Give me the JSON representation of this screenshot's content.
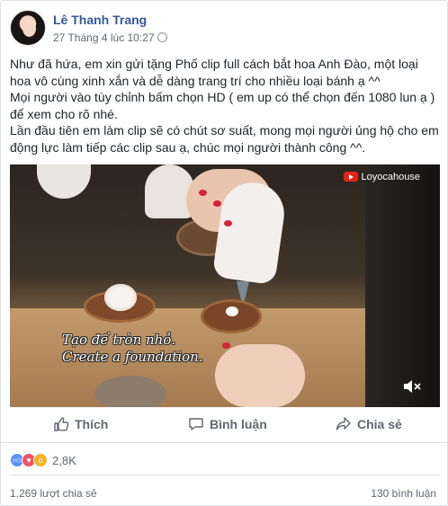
{
  "post": {
    "author": "Lê Thanh Trang",
    "timestamp": "27 Tháng 4 lúc 10:27",
    "privacy_icon": "globe-icon",
    "text_paragraphs": [
      "Như đã hứa, em xin gửi tặng Phố clip full cách bắt hoa Anh Đào, một loại hoa vô cùng xinh xắn và dễ dàng trang trí cho nhiều loại bánh ạ ^^",
      "Mọi người vào tùy chỉnh bấm chọn HD ( em up có thể chọn đến 1080 lun ạ ) để xem cho rõ nhé.",
      "Lần đầu tiên em làm clip sẽ có chút sơ suất, mong mọi người ủng hộ cho em động lực làm tiếp các clip sau ạ, chúc mọi người thành công ^^."
    ]
  },
  "video": {
    "brand": "Loyocahouse",
    "caption_line1": "Tạo đế tròn nhỏ.",
    "caption_line2": "Create a foundation."
  },
  "actions": {
    "like": "Thích",
    "comment": "Bình luận",
    "share": "Chia sẻ"
  },
  "stats": {
    "reactions_count": "2,8K",
    "shares": "1.269 lượt chia sẻ",
    "comments": "130 bình luận"
  },
  "colors": {
    "link": "#365899",
    "muted": "#606770",
    "like": "#5890ff",
    "love": "#f25268",
    "wow": "#f7b125"
  }
}
